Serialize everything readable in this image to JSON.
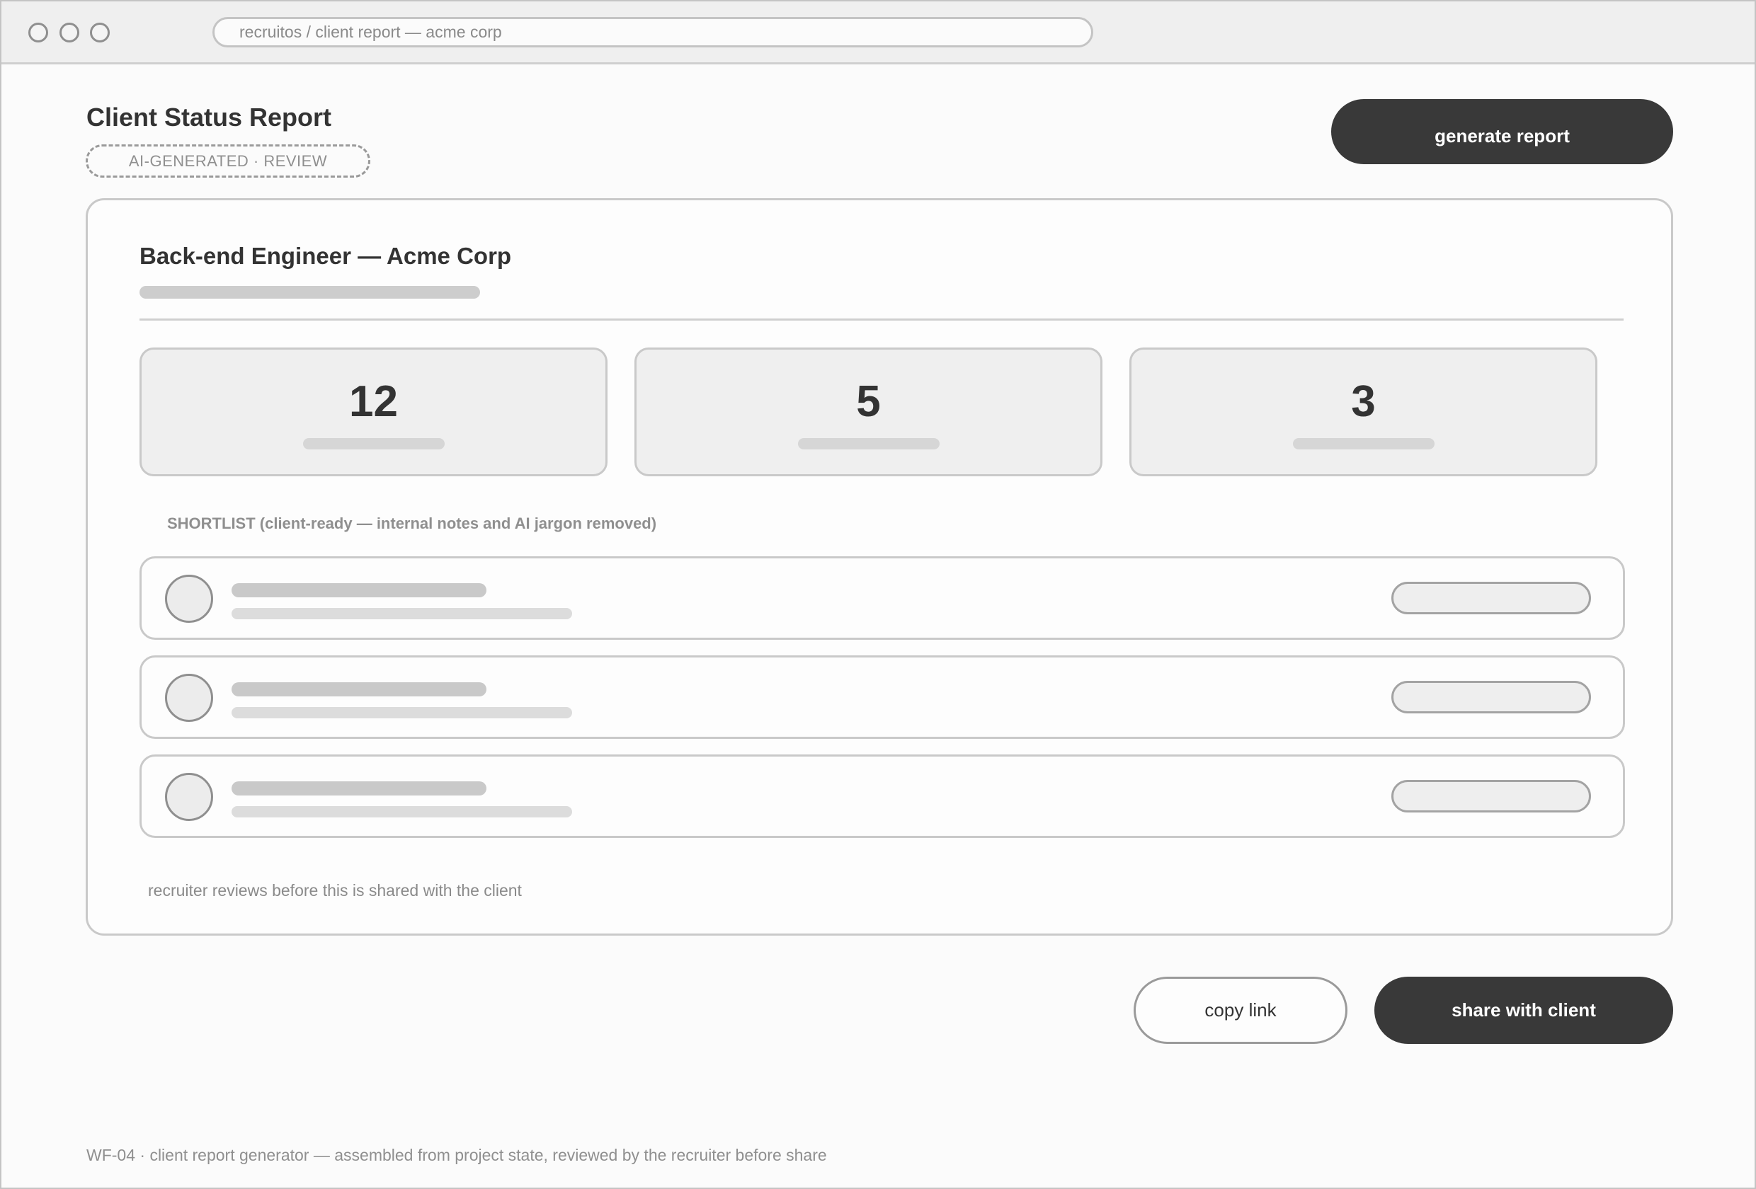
{
  "browser": {
    "url": "recruitos / client report — acme corp"
  },
  "header": {
    "title": "Client Status Report",
    "badge": "AI-GENERATED · REVIEW",
    "generate_label": "generate report"
  },
  "report": {
    "job_title": "Back-end Engineer — Acme Corp",
    "stats": [
      {
        "value": "12"
      },
      {
        "value": "5"
      },
      {
        "value": "3"
      }
    ],
    "shortlist_label": "SHORTLIST (client-ready — internal notes and AI jargon removed)",
    "review_note": "recruiter reviews before this is shared with the client"
  },
  "actions": {
    "copy_label": "copy link",
    "share_label": "share with client"
  },
  "footer": {
    "text": "WF-04 · client report generator — assembled from project state, reviewed by the recruiter before share"
  },
  "colors": {
    "primary": "#393939",
    "border": "#c9c9c9",
    "muted_text": "#8f8f8f"
  }
}
